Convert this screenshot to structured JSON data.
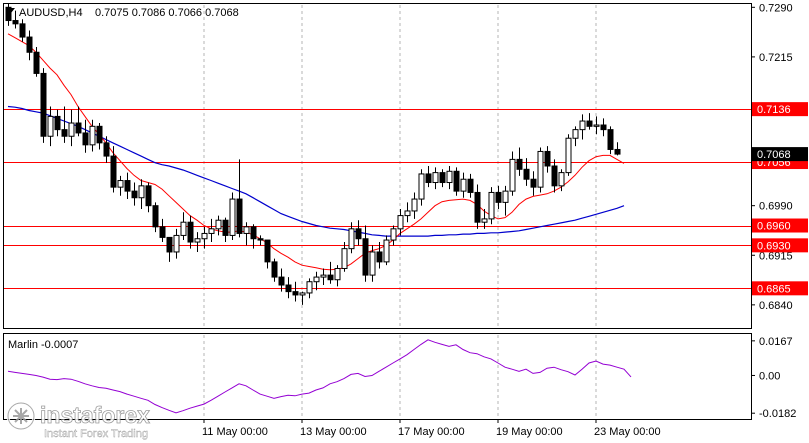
{
  "header": {
    "symbol": "AUDUSD,H4",
    "ohlc": "0.7075 0.7086 0.7066 0.7068"
  },
  "osc": {
    "label": "Marlin -0.0007"
  },
  "watermark": {
    "brand": "instaforex",
    "tagline": "Instant Forex Trading"
  },
  "colors": {
    "bull": "#ffffff",
    "bear": "#000000",
    "level": "#ff0000",
    "ma_fast": "#ff0000",
    "ma_slow": "#0000cd",
    "osc": "#9400d3",
    "grid": "#b4b4b4",
    "price_tag": "#000000"
  },
  "chart_data": [
    {
      "type": "candlestick",
      "symbol": "AUDUSD",
      "timeframe": "H4",
      "ylim": [
        0.6805,
        0.7295
      ],
      "y_ticks": [
        "0.7290",
        "0.7215",
        "0.6990",
        "0.6915",
        "0.6840"
      ],
      "x_ticks": [
        "11 May 00:00",
        "13 May 00:00",
        "17 May 00:00",
        "19 May 00:00",
        "23 May 00:00"
      ],
      "grid": true,
      "candles": [
        [
          0.729,
          0.7295,
          0.7262,
          0.727
        ],
        [
          0.727,
          0.7285,
          0.7258,
          0.7265
        ],
        [
          0.7265,
          0.7272,
          0.7238,
          0.7245
        ],
        [
          0.7245,
          0.7255,
          0.721,
          0.7222
        ],
        [
          0.7222,
          0.723,
          0.7185,
          0.719
        ],
        [
          0.719,
          0.7198,
          0.7085,
          0.7095
        ],
        [
          0.7095,
          0.714,
          0.708,
          0.7125
        ],
        [
          0.7125,
          0.7135,
          0.7095,
          0.7105
        ],
        [
          0.7105,
          0.714,
          0.7085,
          0.7095
        ],
        [
          0.7095,
          0.7135,
          0.708,
          0.7115
        ],
        [
          0.7115,
          0.714,
          0.7095,
          0.71
        ],
        [
          0.71,
          0.712,
          0.707,
          0.7082
        ],
        [
          0.7082,
          0.712,
          0.7072,
          0.711
        ],
        [
          0.711,
          0.7115,
          0.7075,
          0.7085
        ],
        [
          0.7085,
          0.7095,
          0.7055,
          0.7065
        ],
        [
          0.7065,
          0.708,
          0.701,
          0.7018
        ],
        [
          0.7018,
          0.7035,
          0.7005,
          0.7028
        ],
        [
          0.7028,
          0.704,
          0.7,
          0.7012
        ],
        [
          0.7012,
          0.7025,
          0.699,
          0.7002
        ],
        [
          0.7002,
          0.703,
          0.6985,
          0.702
        ],
        [
          0.702,
          0.7025,
          0.698,
          0.699
        ],
        [
          0.699,
          0.6995,
          0.695,
          0.6958
        ],
        [
          0.6958,
          0.697,
          0.6935,
          0.6942
        ],
        [
          0.6942,
          0.6935,
          0.6905,
          0.692
        ],
        [
          0.692,
          0.6955,
          0.691,
          0.6945
        ],
        [
          0.6945,
          0.698,
          0.6938,
          0.6965
        ],
        [
          0.6965,
          0.6975,
          0.6925,
          0.6935
        ],
        [
          0.6935,
          0.695,
          0.692,
          0.694
        ],
        [
          0.694,
          0.6958,
          0.6925,
          0.6948
        ],
        [
          0.6948,
          0.697,
          0.6935,
          0.6955
        ],
        [
          0.6955,
          0.6975,
          0.6945,
          0.6968
        ],
        [
          0.6968,
          0.6972,
          0.6935,
          0.6945
        ],
        [
          0.6945,
          0.701,
          0.6938,
          0.7
        ],
        [
          0.7,
          0.706,
          0.6942,
          0.6948
        ],
        [
          0.6948,
          0.6965,
          0.693,
          0.6958
        ],
        [
          0.6958,
          0.6962,
          0.6925,
          0.694
        ],
        [
          0.694,
          0.6945,
          0.693,
          0.6938
        ],
        [
          0.6938,
          0.693,
          0.6895,
          0.6905
        ],
        [
          0.6905,
          0.691,
          0.6875,
          0.6882
        ],
        [
          0.6882,
          0.6895,
          0.686,
          0.687
        ],
        [
          0.687,
          0.6882,
          0.685,
          0.686
        ],
        [
          0.686,
          0.6875,
          0.6845,
          0.6855
        ],
        [
          0.6855,
          0.686,
          0.684,
          0.6858
        ],
        [
          0.6858,
          0.688,
          0.685,
          0.6875
        ],
        [
          0.6875,
          0.689,
          0.6862,
          0.6882
        ],
        [
          0.6882,
          0.6895,
          0.687,
          0.6885
        ],
        [
          0.6885,
          0.6905,
          0.6872,
          0.6878
        ],
        [
          0.6878,
          0.69,
          0.6868,
          0.6895
        ],
        [
          0.6895,
          0.6935,
          0.689,
          0.6925
        ],
        [
          0.6925,
          0.6965,
          0.6918,
          0.6955
        ],
        [
          0.6955,
          0.6968,
          0.693,
          0.694
        ],
        [
          0.694,
          0.696,
          0.6875,
          0.6885
        ],
        [
          0.6885,
          0.693,
          0.6875,
          0.692
        ],
        [
          0.692,
          0.6935,
          0.6895,
          0.6905
        ],
        [
          0.6905,
          0.6945,
          0.69,
          0.6938
        ],
        [
          0.6938,
          0.696,
          0.693,
          0.6955
        ],
        [
          0.6955,
          0.6985,
          0.6945,
          0.6975
        ],
        [
          0.6975,
          0.6995,
          0.6965,
          0.6982
        ],
        [
          0.6982,
          0.701,
          0.697,
          0.7
        ],
        [
          0.7,
          0.7045,
          0.699,
          0.7038
        ],
        [
          0.7038,
          0.705,
          0.7018,
          0.7025
        ],
        [
          0.7025,
          0.7048,
          0.7015,
          0.704
        ],
        [
          0.704,
          0.7045,
          0.7018,
          0.7025
        ],
        [
          0.7025,
          0.705,
          0.7015,
          0.7042
        ],
        [
          0.7042,
          0.7048,
          0.7005,
          0.7012
        ],
        [
          0.7012,
          0.704,
          0.7002,
          0.703
        ],
        [
          0.703,
          0.7038,
          0.7002,
          0.701
        ],
        [
          0.701,
          0.7022,
          0.6955,
          0.6965
        ],
        [
          0.6965,
          0.6985,
          0.6955,
          0.697
        ],
        [
          0.697,
          0.7018,
          0.6962,
          0.701
        ],
        [
          0.701,
          0.702,
          0.6985,
          0.6995
        ],
        [
          0.6995,
          0.702,
          0.6975,
          0.7012
        ],
        [
          0.7012,
          0.7072,
          0.7005,
          0.706
        ],
        [
          0.706,
          0.7078,
          0.7035,
          0.7045
        ],
        [
          0.7045,
          0.7062,
          0.702,
          0.703
        ],
        [
          0.703,
          0.7042,
          0.7005,
          0.7018
        ],
        [
          0.7018,
          0.7078,
          0.701,
          0.7072
        ],
        [
          0.7072,
          0.708,
          0.704,
          0.705
        ],
        [
          0.705,
          0.706,
          0.701,
          0.702
        ],
        [
          0.702,
          0.7045,
          0.7012,
          0.704
        ],
        [
          0.704,
          0.7098,
          0.7035,
          0.7092
        ],
        [
          0.7092,
          0.711,
          0.708,
          0.7105
        ],
        [
          0.7105,
          0.7128,
          0.709,
          0.7118
        ],
        [
          0.7118,
          0.713,
          0.7105,
          0.711
        ],
        [
          0.711,
          0.7125,
          0.7098,
          0.7112
        ],
        [
          0.7112,
          0.7122,
          0.7095,
          0.7105
        ],
        [
          0.7105,
          0.711,
          0.7068,
          0.7075
        ],
        [
          0.7075,
          0.7086,
          0.7066,
          0.7068
        ]
      ],
      "moving_average_fast": [
        0.725,
        0.7244,
        0.7238,
        0.7232,
        0.7222,
        0.721,
        0.7198,
        0.7188,
        0.7172,
        0.7158,
        0.714,
        0.7125,
        0.711,
        0.7098,
        0.7085,
        0.707,
        0.7058,
        0.7046,
        0.7036,
        0.7028,
        0.7025,
        0.7022,
        0.7015,
        0.7005,
        0.6995,
        0.6985,
        0.6975,
        0.6968,
        0.696,
        0.6955,
        0.6952,
        0.695,
        0.695,
        0.6952,
        0.695,
        0.6946,
        0.694,
        0.6934,
        0.6925,
        0.6918,
        0.6912,
        0.6905,
        0.69,
        0.6898,
        0.6896,
        0.6894,
        0.6893,
        0.6894,
        0.6896,
        0.6902,
        0.691,
        0.6918,
        0.6922,
        0.6925,
        0.693,
        0.6938,
        0.6948,
        0.6955,
        0.6962,
        0.697,
        0.698,
        0.699,
        0.6996,
        0.6998,
        0.6999,
        0.7,
        0.6998,
        0.6992,
        0.6982,
        0.6975,
        0.697,
        0.6972,
        0.698,
        0.6992,
        0.7,
        0.7004,
        0.7006,
        0.7008,
        0.7012,
        0.7018,
        0.7026,
        0.7036,
        0.7048,
        0.7058,
        0.7064,
        0.7066,
        0.7066,
        0.706,
        0.7054
      ],
      "moving_average_slow": [
        0.714,
        0.7139,
        0.7137,
        0.7134,
        0.7132,
        0.713,
        0.7126,
        0.7122,
        0.7118,
        0.7114,
        0.711,
        0.7105,
        0.71,
        0.7095,
        0.709,
        0.7085,
        0.708,
        0.7075,
        0.707,
        0.7065,
        0.706,
        0.7055,
        0.7052,
        0.705,
        0.7047,
        0.7044,
        0.704,
        0.7036,
        0.7032,
        0.7028,
        0.7024,
        0.702,
        0.7016,
        0.7012,
        0.7008,
        0.7002,
        0.6996,
        0.699,
        0.6984,
        0.6978,
        0.6974,
        0.697,
        0.6966,
        0.6963,
        0.696,
        0.6958,
        0.6956,
        0.6955,
        0.6954,
        0.6952,
        0.695,
        0.6948,
        0.6946,
        0.6945,
        0.6944,
        0.6944,
        0.6944,
        0.6944,
        0.6944,
        0.6944,
        0.6944,
        0.6945,
        0.6945,
        0.6946,
        0.6946,
        0.6947,
        0.6947,
        0.6948,
        0.6948,
        0.6949,
        0.6949,
        0.695,
        0.6951,
        0.6952,
        0.6954,
        0.6956,
        0.6958,
        0.696,
        0.6962,
        0.6964,
        0.6966,
        0.6968,
        0.6971,
        0.6974,
        0.6977,
        0.698,
        0.6983,
        0.6986,
        0.699
      ],
      "levels": [
        {
          "value": 0.7136,
          "label": "0.7136"
        },
        {
          "value": 0.7056,
          "label": "0.7056"
        },
        {
          "value": 0.696,
          "label": "0.6960"
        },
        {
          "value": 0.693,
          "label": "0.6930"
        },
        {
          "value": 0.6865,
          "label": "0.6865"
        }
      ],
      "current_price": {
        "value": 0.7068,
        "label": "0.7068"
      }
    },
    {
      "type": "line",
      "name": "Marlin",
      "ylim": [
        -0.021,
        0.02
      ],
      "y_ticks": [
        "0.0167",
        "0.00",
        "-0.0182"
      ],
      "values": [
        0.002,
        0.0015,
        0.001,
        0.0005,
        0.0,
        -0.0008,
        -0.0018,
        -0.002,
        -0.0015,
        -0.0018,
        -0.0028,
        -0.004,
        -0.005,
        -0.0058,
        -0.0062,
        -0.007,
        -0.0078,
        -0.009,
        -0.01,
        -0.011,
        -0.012,
        -0.014,
        -0.0155,
        -0.0168,
        -0.018,
        -0.017,
        -0.0158,
        -0.0148,
        -0.0138,
        -0.012,
        -0.01,
        -0.008,
        -0.006,
        -0.004,
        -0.005,
        -0.007,
        -0.009,
        -0.01,
        -0.011,
        -0.0102,
        -0.0095,
        -0.0098,
        -0.009,
        -0.0085,
        -0.007,
        -0.006,
        -0.004,
        -0.003,
        -0.0015,
        0.0005,
        0.001,
        -0.0005,
        0.0,
        0.002,
        0.004,
        0.006,
        0.008,
        0.01,
        0.0125,
        0.015,
        0.0172,
        0.016,
        0.015,
        0.014,
        0.0148,
        0.0125,
        0.011,
        0.0105,
        0.009,
        0.008,
        0.006,
        0.004,
        0.003,
        0.002,
        0.003,
        0.001,
        0.0015,
        0.0035,
        0.004,
        0.0028,
        0.0018,
        0.0002,
        0.003,
        0.006,
        0.007,
        0.0055,
        0.005,
        0.004,
        0.003,
        -0.0007
      ]
    }
  ]
}
